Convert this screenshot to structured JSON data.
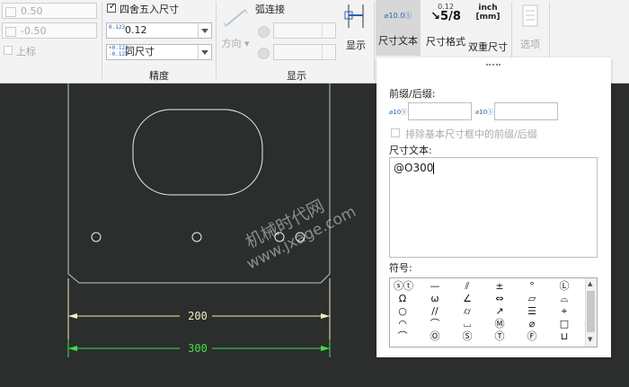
{
  "ribbon": {
    "upper_tol": "0.50",
    "lower_tol": "-0.50",
    "superscript_label": "上标",
    "round_label": "四舍五入尺寸",
    "precision_value": "0.12",
    "precision_icon": "0.123",
    "tol_precision_value": "同尺寸",
    "tol_precision_icon": "+0.123\n-0.123",
    "precision_group": "精度",
    "arc_label": "弧连接",
    "direction_label": "方向",
    "display_btn": "显示",
    "display_group": "显示",
    "dim_text_btn": "尺寸文本",
    "dim_text_icon": "⌀10.0ⓢ",
    "dim_format_btn": "尺寸格式",
    "dim_format_icon_top": "0.12",
    "dim_format_icon_bottom": "5/8",
    "dual_dim_btn": "双重尺寸",
    "dual_icon_top": "inch",
    "dual_icon_bottom": "[mm]",
    "options_btn": "选项"
  },
  "panel": {
    "prefix_suffix_label": "前缀/后缀:",
    "prefix_icon": "⌀10ⓢ",
    "suffix_icon": "⌀10ⓢ",
    "exclude_label": "排除基本尺寸框中的前缀/后缀",
    "dim_text_label": "尺寸文本:",
    "dim_text_value": "@O300",
    "symbols_label": "符号:",
    "symbols": [
      "ⓢⓣ",
      "—",
      "⫽",
      "±",
      "°",
      "Ⓛ",
      "Ω",
      "ω",
      "∠",
      "⇔",
      "▱",
      "⌓",
      "○",
      "//",
      "⌭",
      "↗",
      "☰",
      "⌖",
      "◠",
      "⌒",
      "⌴",
      "Ⓜ",
      "⌀",
      "□",
      "Ⓟ",
      "⌒",
      "₵",
      "Ⓞ",
      "Ⓢ",
      "Ⓣ",
      "Ⓕ",
      "⊔"
    ]
  },
  "drawing": {
    "dim_200": "200",
    "dim_300": "300",
    "watermark_line1": "机械时代网",
    "watermark_line2": "www.jxage.com"
  },
  "colors": {
    "canvas": "#2b2e2d",
    "part_line": "#b9c8cc",
    "dim_yellow": "#f2eebc",
    "dim_green": "#3ee04a"
  }
}
